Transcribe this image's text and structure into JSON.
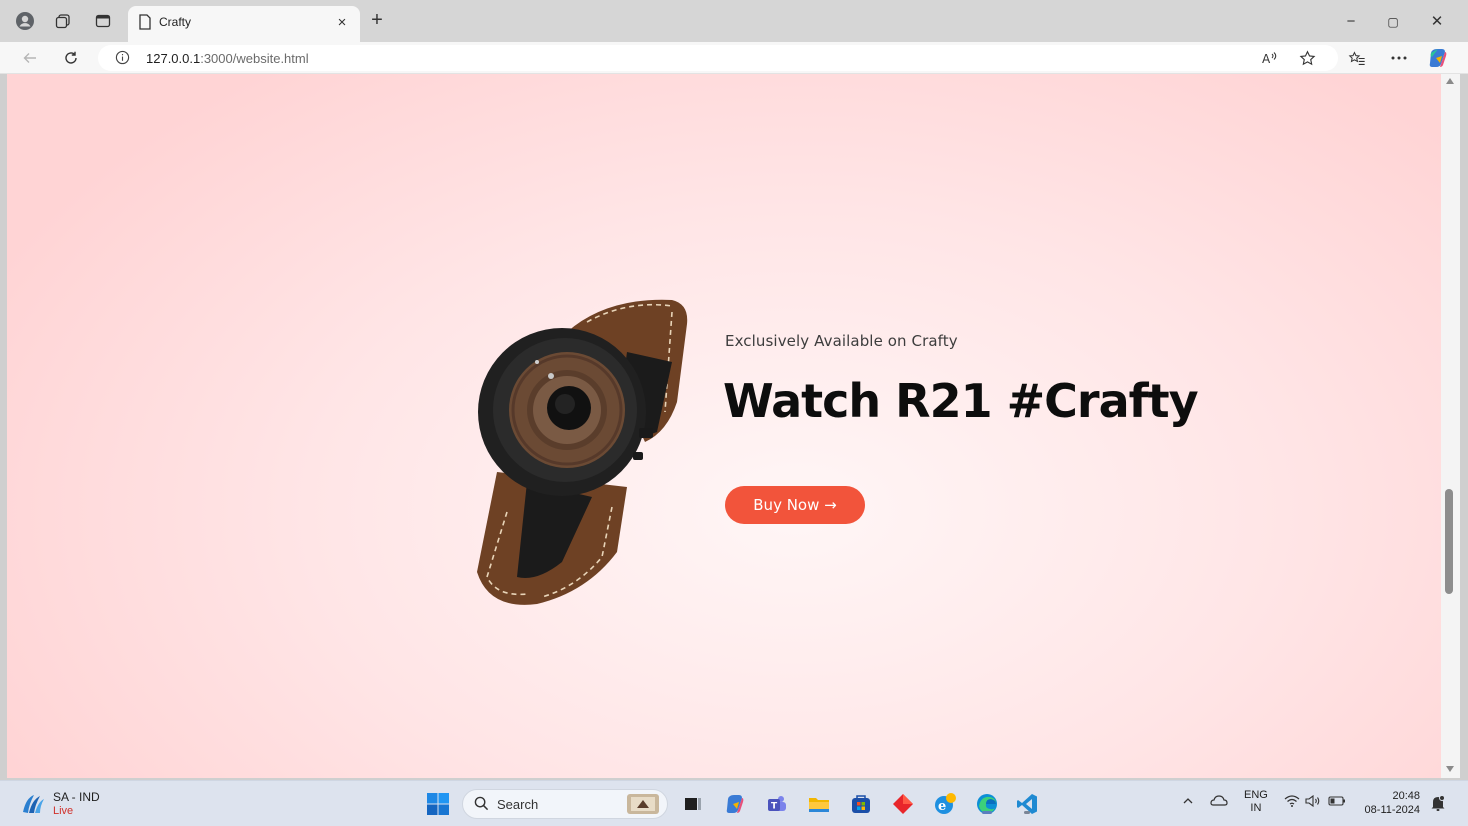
{
  "browser": {
    "tab_title": "Crafty",
    "tab_close_glyph": "×",
    "new_tab_glyph": "+",
    "url_host": "127.0.0.1",
    "url_path": ":3000/website.html",
    "icons": [
      "profile-icon",
      "workspaces-icon",
      "tab-actions-icon",
      "page-icon",
      "back-icon",
      "refresh-icon",
      "site-info-icon",
      "read-aloud-icon",
      "favorite-star-icon",
      "favorites-icon",
      "more-icon",
      "copilot-icon"
    ],
    "window_controls": [
      "−",
      "▢",
      "✕"
    ]
  },
  "page": {
    "subtitle": "Exclusively Available on Crafty",
    "title": "Watch R21 #Crafty",
    "cta": "Buy Now →",
    "colors": {
      "accent": "#f2543b",
      "background": "#ffe5e6",
      "title": "#0d0d0d"
    }
  },
  "taskbar": {
    "weather_title": "SA - IND",
    "weather_sub": "Live",
    "search_label": "Search",
    "apps": [
      "start-icon",
      "search-icon",
      "widgets-icon",
      "task-view-icon",
      "copilot-icon",
      "teams-icon",
      "file-explorer-icon",
      "store-icon",
      "red-diamond-app-icon",
      "ie-icon",
      "edge-icon",
      "vscode-icon"
    ],
    "tray": {
      "lang_top": "ENG",
      "lang_bottom": "IN",
      "time": "20:48",
      "date": "08-11-2024"
    }
  }
}
